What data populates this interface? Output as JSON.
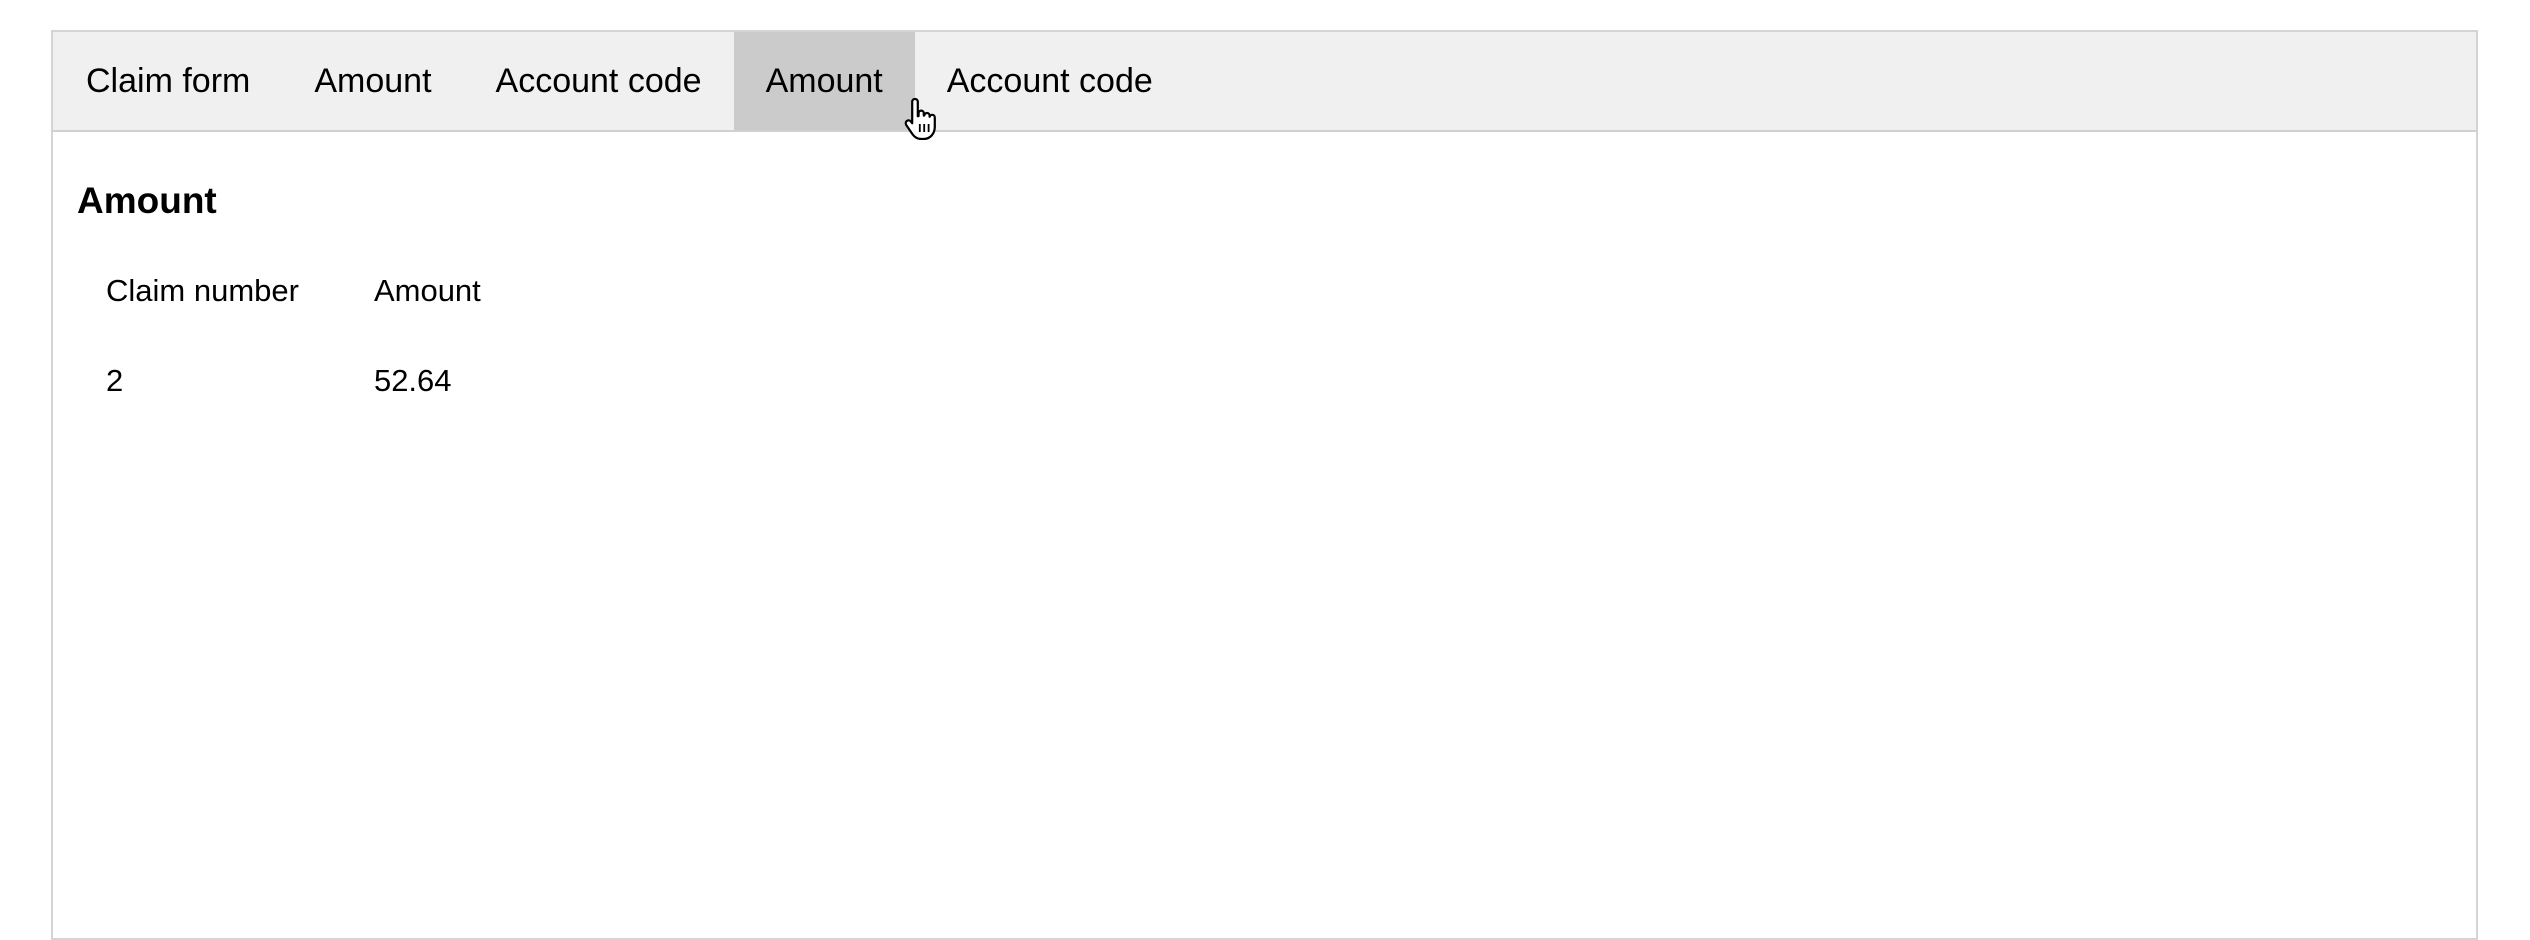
{
  "tabs": [
    {
      "label": "Claim form",
      "active": false
    },
    {
      "label": "Amount",
      "active": false
    },
    {
      "label": "Account code",
      "active": false
    },
    {
      "label": "Amount",
      "active": true
    },
    {
      "label": "Account code",
      "active": false
    }
  ],
  "panel": {
    "heading": "Amount",
    "table": {
      "headers": [
        "Claim number",
        "Amount"
      ],
      "rows": [
        [
          "2",
          "52.64"
        ]
      ]
    }
  },
  "colors": {
    "tabbar_bg": "#f0f0f0",
    "active_tab_bg": "#cbcbcb",
    "border": "#d4d4d4"
  },
  "cursor": {
    "icon": "hand-pointer-icon"
  }
}
